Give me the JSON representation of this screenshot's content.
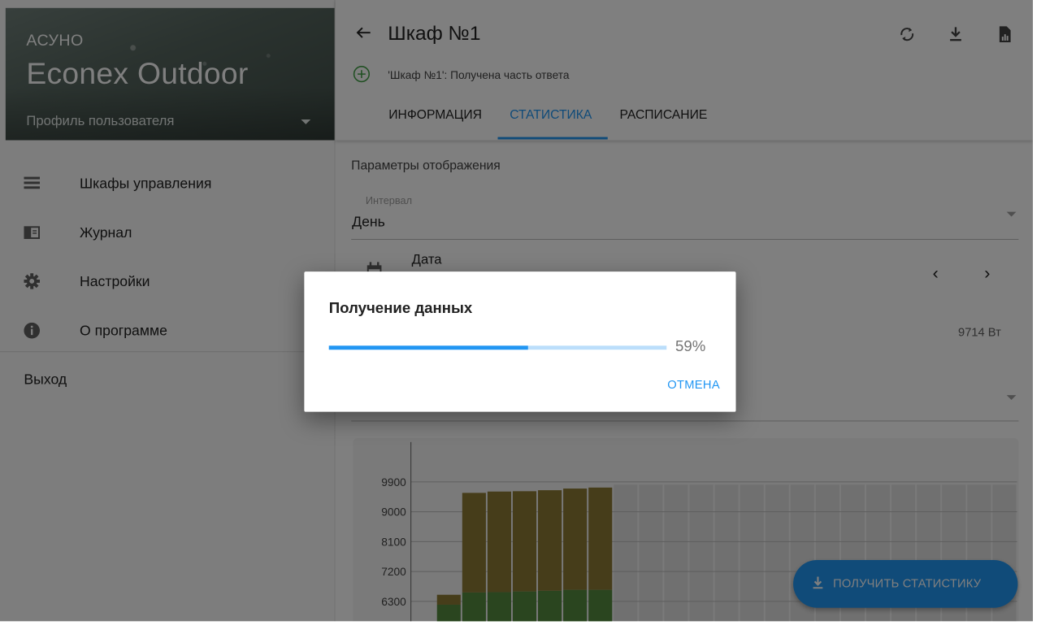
{
  "sidebar": {
    "brand_small": "АСУНО",
    "brand_name": "Econex Outdoor",
    "profile_label": "Профиль пользователя",
    "items": [
      {
        "label": "Шкафы управления",
        "icon": "list-icon"
      },
      {
        "label": "Журнал",
        "icon": "journal-icon"
      },
      {
        "label": "Настройки",
        "icon": "gear-icon"
      },
      {
        "label": "О программе",
        "icon": "info-icon"
      }
    ],
    "logout_label": "Выход"
  },
  "header": {
    "title": "Шкаф №1",
    "status_text": "'Шкаф №1': Получена часть ответа",
    "tabs": [
      {
        "label": "ИНФОРМАЦИЯ",
        "active": false
      },
      {
        "label": "СТАТИСТИКА",
        "active": true
      },
      {
        "label": "РАСПИСАНИЕ",
        "active": false
      }
    ]
  },
  "params": {
    "section_title": "Параметры отображения",
    "interval_label": "Интервал",
    "interval_value": "День",
    "date_label": "Дата",
    "power_value": "9714 Вт"
  },
  "chart_data": {
    "type": "bar",
    "y_ticks": [
      6300,
      7200,
      8100,
      9000,
      9900
    ],
    "ylim": [
      6000,
      10100
    ],
    "stacked": true,
    "series": [
      {
        "color": "#558b3f",
        "values": [
          null,
          6200,
          6570,
          6580,
          6600,
          6620,
          6650,
          6650,
          null,
          null,
          null,
          null,
          null,
          null,
          null,
          null,
          null,
          null,
          null,
          null,
          null,
          null,
          null,
          null
        ]
      },
      {
        "color": "#8d7a35",
        "values": [
          null,
          300,
          3000,
          3030,
          3020,
          3030,
          3050,
          3080,
          null,
          null,
          null,
          null,
          null,
          null,
          null,
          null,
          null,
          null,
          null,
          null,
          null,
          null,
          null,
          null
        ]
      }
    ],
    "background_color": "#e0e0e0"
  },
  "fab": {
    "label": "ПОЛУЧИТЬ СТАТИСТИКУ"
  },
  "dialog": {
    "title": "Получение данных",
    "progress": 0.59,
    "percent_label": "59%",
    "cancel_label": "ОТМЕНА"
  },
  "colors": {
    "accent": "#2196f3"
  }
}
